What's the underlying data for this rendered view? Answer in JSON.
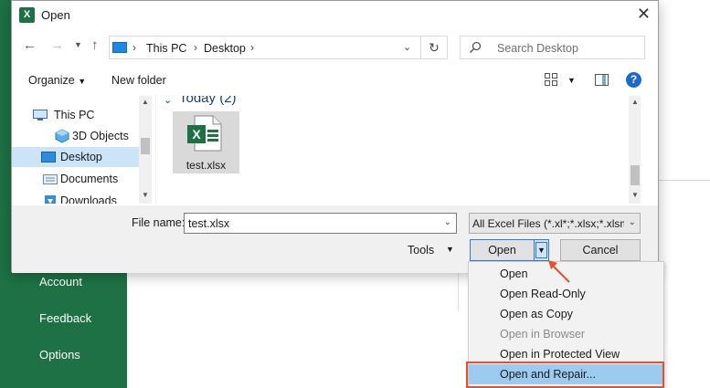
{
  "backstage": {
    "nav_items": [
      "Account",
      "Feedback",
      "Options"
    ]
  },
  "dialog": {
    "title": "Open",
    "app_icon_letter": "X",
    "close_glyph": "✕",
    "address": {
      "crumbs": [
        "This PC",
        "Desktop"
      ]
    },
    "search": {
      "placeholder": "Search Desktop"
    },
    "commands": {
      "organize": "Organize",
      "new_folder": "New folder",
      "help": "?"
    },
    "sidebar": {
      "items": [
        "This PC",
        "3D Objects",
        "Desktop",
        "Documents",
        "Downloads"
      ],
      "selected": "Desktop"
    },
    "files": {
      "group_header": "Today (2)",
      "items": [
        {
          "name": "test.xlsx",
          "icon": "excel-file-icon"
        }
      ]
    },
    "file_name_label": "File name:",
    "file_name_value": "test.xlsx",
    "file_type_value": "All Excel Files (*.xl*;*.xlsx;*.xlsm;*.xlsb",
    "tools_label": "Tools",
    "open_label": "Open",
    "cancel_label": "Cancel"
  },
  "open_menu": {
    "items": [
      {
        "label": "Open",
        "enabled": true
      },
      {
        "label": "Open Read-Only",
        "enabled": true
      },
      {
        "label": "Open as Copy",
        "enabled": true
      },
      {
        "label": "Open in Browser",
        "enabled": false
      },
      {
        "label": "Open in Protected View",
        "enabled": true
      },
      {
        "label": "Open and Repair...",
        "enabled": true,
        "highlighted": true
      }
    ]
  },
  "colors": {
    "excel_green": "#1e7145",
    "selection_blue": "#cce4f7",
    "menu_highlight": "#9ccbf2",
    "annotation_orange": "#e8502b"
  }
}
